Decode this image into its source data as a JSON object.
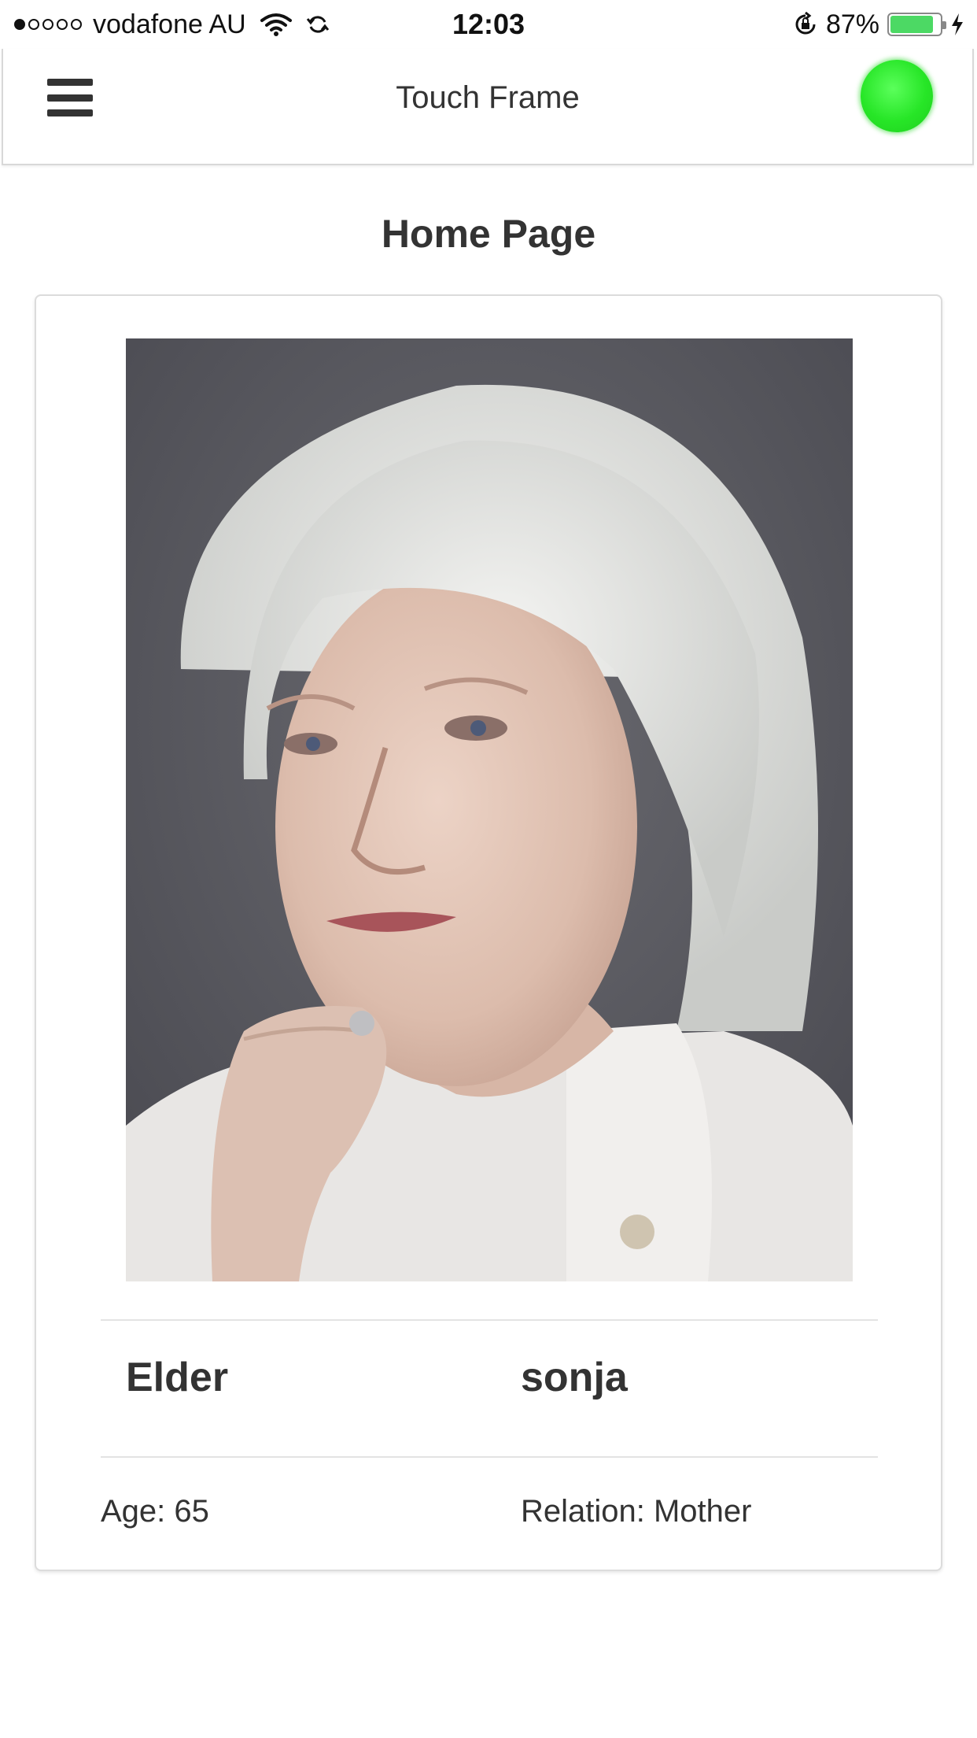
{
  "status_bar": {
    "carrier": "vodafone AU",
    "time": "12:03",
    "battery_percent": "87%",
    "battery_level": 0.87,
    "signal_bars_filled": 1,
    "signal_bars_total": 5,
    "battery_color": "#4cd964"
  },
  "nav": {
    "title": "Touch Frame",
    "menu_icon": "hamburger-menu-icon",
    "status_indicator_color": "#27e627"
  },
  "page": {
    "title": "Home Page"
  },
  "profile": {
    "photo_description_icon": "portrait-photo",
    "role": "Elder",
    "name": "sonja",
    "age": "Age: 65",
    "relation": "Relation: Mother"
  }
}
